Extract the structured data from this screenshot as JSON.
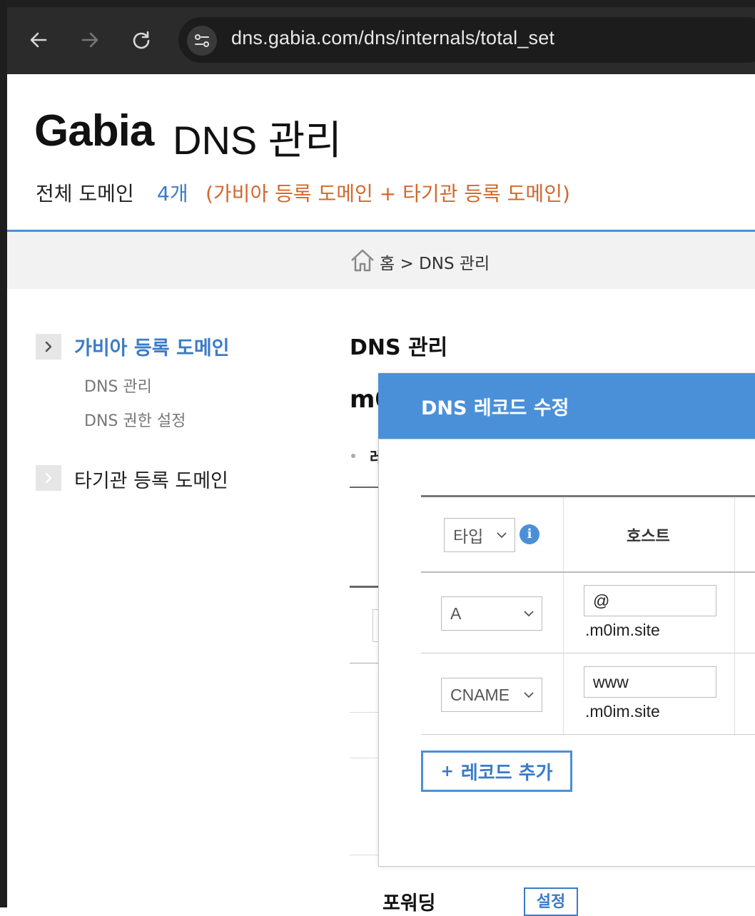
{
  "browser": {
    "url": "dns.gabia.com/dns/internals/total_set"
  },
  "header": {
    "logo": "Gabia",
    "logo_sub": "DNS 관리",
    "total_label": "전체 도메인",
    "total_count": "4개",
    "total_note": "(가비아 등록 도메인 + 타기관 등록 도메인)"
  },
  "breadcrumb": {
    "text": "홈 > DNS 관리"
  },
  "sidebar": {
    "group1": {
      "label": "가비아 등록 도메인",
      "items": [
        {
          "label": "DNS 관리"
        },
        {
          "label": "DNS 권한 설정"
        }
      ]
    },
    "group2": {
      "label": "타기관 등록 도메인"
    }
  },
  "main": {
    "title": "DNS 관리",
    "domain_partial": "m0",
    "bullet_partial": "레",
    "forwarding_label": "포워딩",
    "forwarding_button": "설정"
  },
  "modal": {
    "title": "DNS 레코드 수정",
    "type_header": "타입",
    "host_header": "호스트",
    "records": [
      {
        "type": "A",
        "host": "@",
        "suffix": ".m0im.site"
      },
      {
        "type": "CNAME",
        "host": "www",
        "suffix": ".m0im.site"
      }
    ],
    "add_button": "레코드 추가",
    "add_icon": "+"
  },
  "colors": {
    "accent": "#4a90d9",
    "link": "#3a7bc8",
    "note": "#d2682d"
  }
}
